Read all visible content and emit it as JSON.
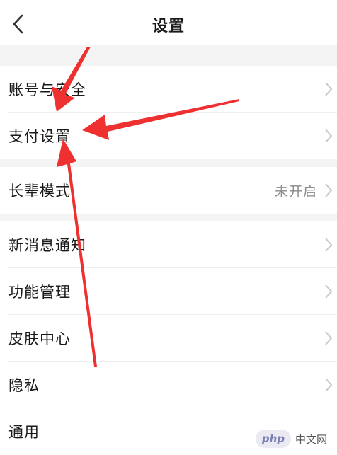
{
  "header": {
    "title": "设置",
    "back_icon": "chevron-left-icon"
  },
  "groups": [
    {
      "items": [
        {
          "label": "账号与安全"
        },
        {
          "label": "支付设置"
        }
      ]
    },
    {
      "items": [
        {
          "label": "长辈模式",
          "status": "未开启"
        }
      ]
    },
    {
      "items": [
        {
          "label": "新消息通知"
        },
        {
          "label": "功能管理"
        },
        {
          "label": "皮肤中心"
        },
        {
          "label": "隐私"
        },
        {
          "label": "通用"
        }
      ]
    }
  ],
  "annotation": {
    "arrow_color": "#ee3030",
    "arrow_count": 3
  },
  "watermark": {
    "logo_text": "php",
    "text": "中文网"
  },
  "colors": {
    "page_bg": "#f4f4f4",
    "card_bg": "#ffffff",
    "divider": "#efefef",
    "chevron": "#c8c8c8",
    "status_text": "#8a8a8a"
  }
}
